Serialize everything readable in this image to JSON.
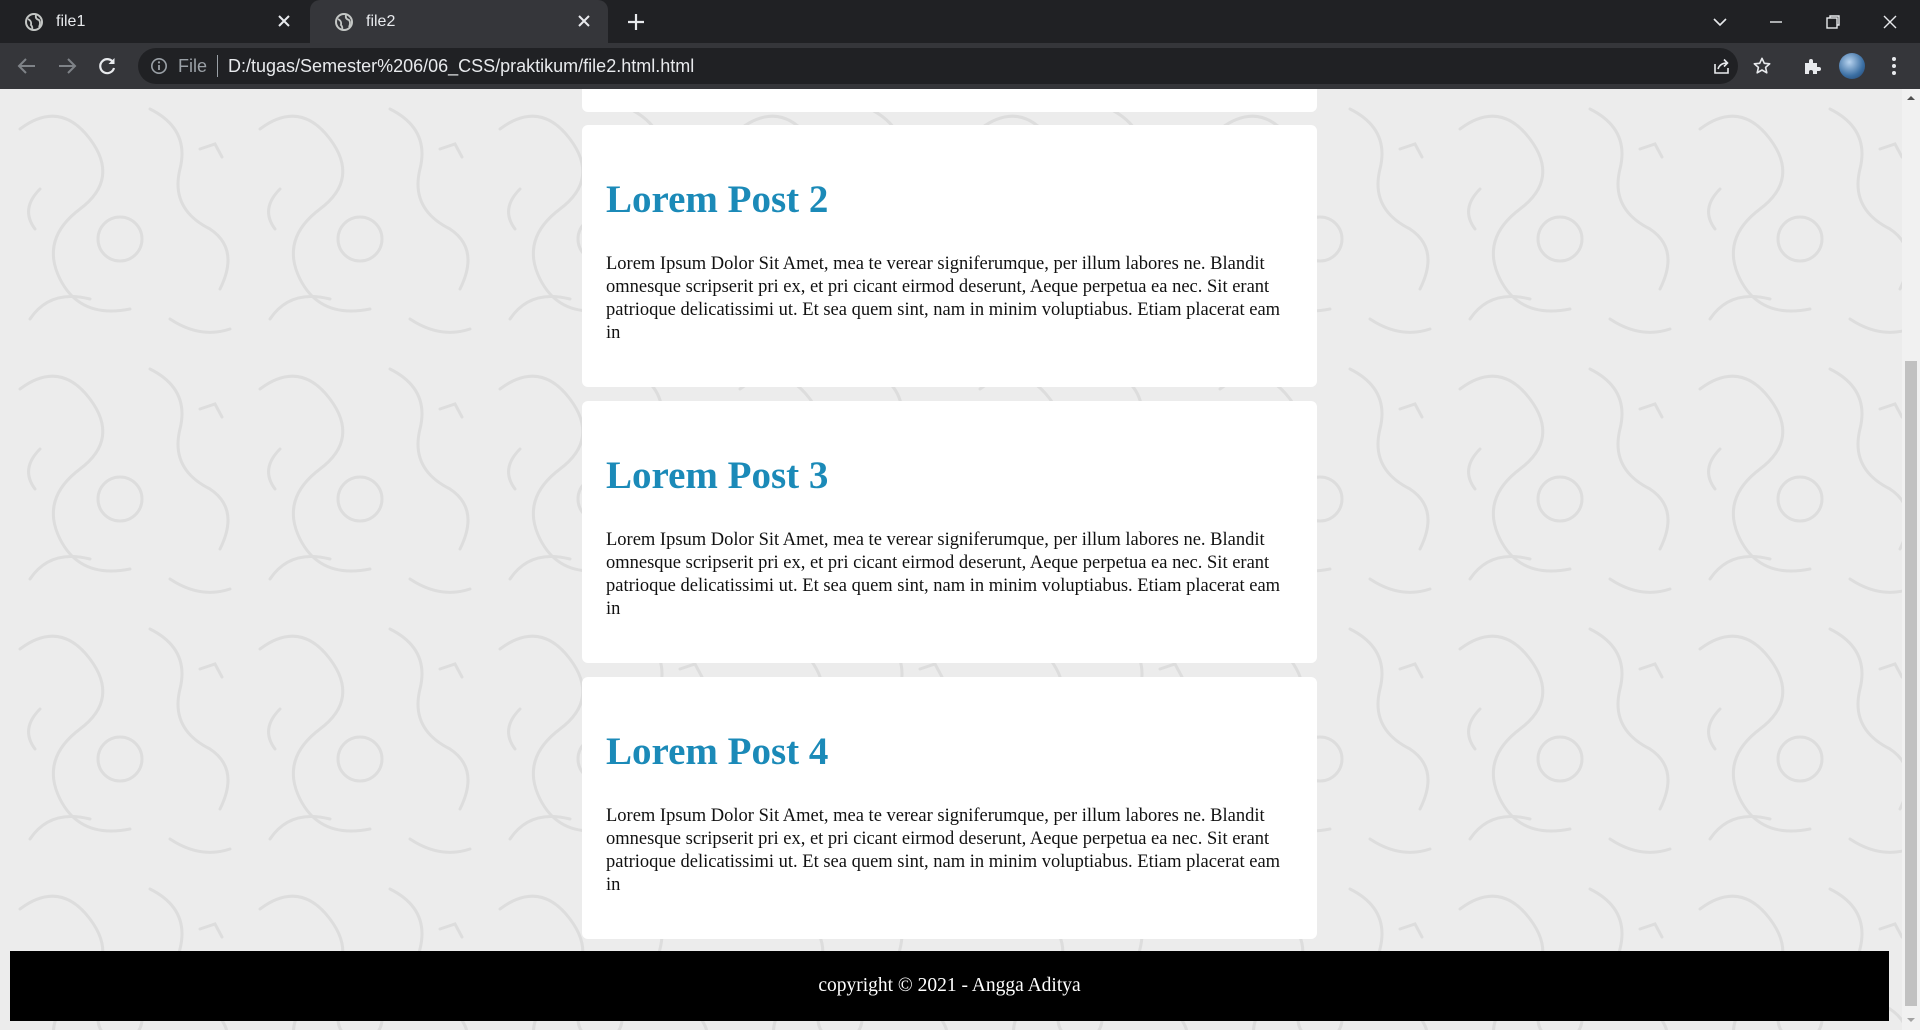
{
  "browser": {
    "tabs": [
      {
        "title": "file1",
        "active": false
      },
      {
        "title": "file2",
        "active": true
      }
    ],
    "address": {
      "scheme_label": "File",
      "url": "D:/tugas/Semester%206/06_CSS/praktikum/file2.html.html"
    }
  },
  "page": {
    "posts": [
      {
        "title": "Lorem Post 2",
        "body": "Lorem Ipsum Dolor Sit Amet, mea te verear signiferumque, per illum labores ne. Blandit omnesque scripserit pri ex, et pri cicant eirmod deserunt, Aeque perpetua ea nec. Sit erant patrioque delicatissimi ut. Et sea quem sint, nam in minim voluptiabus. Etiam placerat eam in"
      },
      {
        "title": "Lorem Post 3",
        "body": "Lorem Ipsum Dolor Sit Amet, mea te verear signiferumque, per illum labores ne. Blandit omnesque scripserit pri ex, et pri cicant eirmod deserunt, Aeque perpetua ea nec. Sit erant patrioque delicatissimi ut. Et sea quem sint, nam in minim voluptiabus. Etiam placerat eam in"
      },
      {
        "title": "Lorem Post 4",
        "body": "Lorem Ipsum Dolor Sit Amet, mea te verear signiferumque, per illum labores ne. Blandit omnesque scripserit pri ex, et pri cicant eirmod deserunt, Aeque perpetua ea nec. Sit erant patrioque delicatissimi ut. Et sea quem sint, nam in minim voluptiabus. Etiam placerat eam in"
      }
    ],
    "footer": "copyright © 2021 - Angga Aditya"
  },
  "colors": {
    "heading": "#1b8ab8",
    "chrome_dark": "#202124",
    "chrome_toolbar": "#35363a",
    "page_bg": "#ececec"
  },
  "icons": [
    "globe-icon",
    "close-icon",
    "plus-icon",
    "chevron-down-icon",
    "minimize-icon",
    "restore-icon",
    "back-arrow-icon",
    "forward-arrow-icon",
    "reload-icon",
    "info-icon",
    "share-icon",
    "star-icon",
    "puzzle-icon",
    "avatar",
    "more-vert-icon"
  ]
}
